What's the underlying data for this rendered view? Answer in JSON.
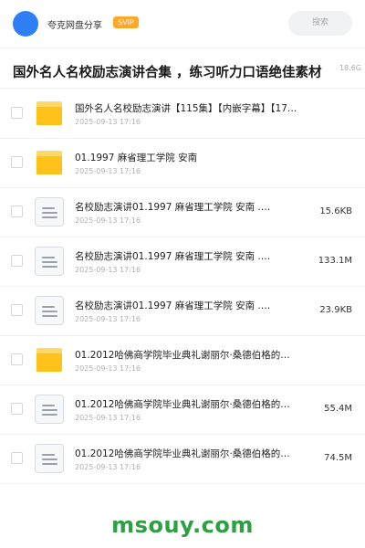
{
  "header": {
    "username": "夸克网盘分享",
    "badge": "SVIP",
    "search_placeholder": "搜索",
    "accent_color": "#2f7ef5",
    "badge_color": "#ffa726"
  },
  "share": {
    "title": "国外名人名校励志演讲合集 ，练习听力口语绝佳素材",
    "total_size": "18.6G"
  },
  "files": [
    {
      "type": "folder",
      "icon": "folder-icon",
      "name": "国外名人名校励志演讲【115集】【内嵌字幕】【17…",
      "date": "2025-09-13 17:16",
      "size": ""
    },
    {
      "type": "folder",
      "icon": "folder-icon",
      "name": "01.1997 麻省理工学院 安南",
      "date": "2025-09-13 17:16",
      "size": ""
    },
    {
      "type": "file",
      "icon": "document-icon",
      "name": "名校励志演讲01.1997 麻省理工学院 安南 .…",
      "date": "2025-09-13 17:16",
      "size": "15.6KB"
    },
    {
      "type": "file",
      "icon": "document-icon",
      "name": "名校励志演讲01.1997 麻省理工学院 安南 .…",
      "date": "2025-09-13 17:16",
      "size": "133.1M"
    },
    {
      "type": "file",
      "icon": "document-icon",
      "name": "名校励志演讲01.1997 麻省理工学院 安南 .…",
      "date": "2025-09-13 17:16",
      "size": "23.9KB"
    },
    {
      "type": "folder",
      "icon": "folder-icon",
      "name": "01.2012哈佛商学院毕业典礼谢丽尔·桑德伯格的…",
      "date": "2025-09-13 17:16",
      "size": ""
    },
    {
      "type": "file",
      "icon": "document-icon",
      "name": "01.2012哈佛商学院毕业典礼谢丽尔·桑德伯格的…",
      "date": "2025-09-13 17:16",
      "size": "55.4M"
    },
    {
      "type": "file",
      "icon": "document-icon",
      "name": "01.2012哈佛商学院毕业典礼谢丽尔·桑德伯格的…",
      "date": "2025-09-13 17:16",
      "size": "74.5M"
    }
  ],
  "watermark": "msouy.com"
}
